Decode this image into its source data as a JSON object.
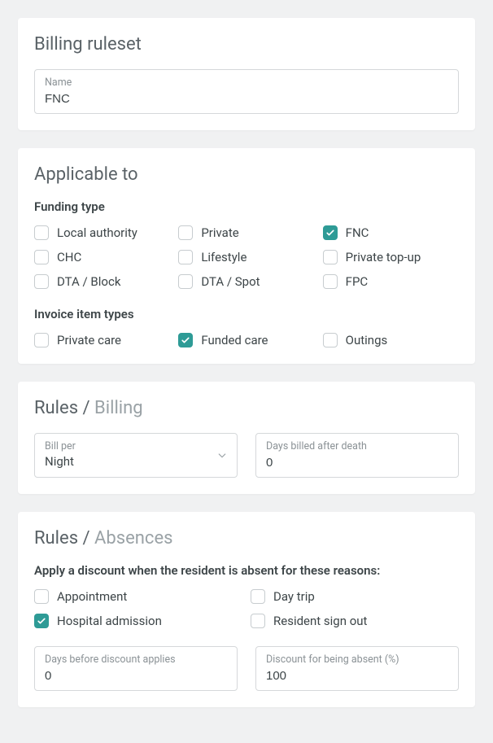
{
  "ruleset": {
    "title": "Billing ruleset",
    "name_label": "Name",
    "name_value": "FNC"
  },
  "applicable": {
    "title": "Applicable to",
    "funding_type_label": "Funding type",
    "funding_types": [
      {
        "label": "Local authority",
        "checked": false
      },
      {
        "label": "Private",
        "checked": false
      },
      {
        "label": "FNC",
        "checked": true
      },
      {
        "label": "CHC",
        "checked": false
      },
      {
        "label": "Lifestyle",
        "checked": false
      },
      {
        "label": "Private top-up",
        "checked": false
      },
      {
        "label": "DTA / Block",
        "checked": false
      },
      {
        "label": "DTA / Spot",
        "checked": false
      },
      {
        "label": "FPC",
        "checked": false
      }
    ],
    "invoice_item_types_label": "Invoice item types",
    "invoice_item_types": [
      {
        "label": "Private care",
        "checked": false
      },
      {
        "label": "Funded care",
        "checked": true
      },
      {
        "label": "Outings",
        "checked": false
      }
    ]
  },
  "rules_billing": {
    "title_prefix": "Rules / ",
    "title_suffix": "Billing",
    "bill_per_label": "Bill per",
    "bill_per_value": "Night",
    "days_after_death_label": "Days billed after death",
    "days_after_death_value": "0"
  },
  "rules_absences": {
    "title_prefix": "Rules / ",
    "title_suffix": "Absences",
    "description": "Apply a discount when the resident is absent for these reasons:",
    "reasons": [
      {
        "label": "Appointment",
        "checked": false
      },
      {
        "label": "Day trip",
        "checked": false
      },
      {
        "label": "Hospital admission",
        "checked": true
      },
      {
        "label": "Resident sign out",
        "checked": false
      }
    ],
    "days_before_label": "Days before discount applies",
    "days_before_value": "0",
    "discount_pct_label": "Discount for being absent (%)",
    "discount_pct_value": "100"
  }
}
